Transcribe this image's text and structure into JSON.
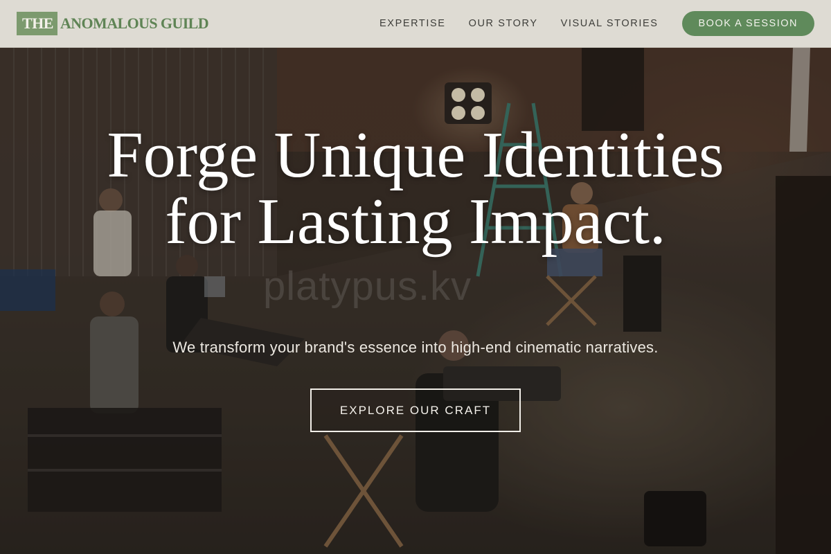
{
  "header": {
    "logo": {
      "highlight": "THE",
      "rest": "ANOMALOUS GUILD"
    },
    "nav": {
      "items": [
        {
          "label": "EXPERTISE"
        },
        {
          "label": "OUR STORY"
        },
        {
          "label": "VISUAL STORIES"
        }
      ],
      "cta_label": "BOOK A SESSION"
    }
  },
  "hero": {
    "title": "Forge Unique Identities for Lasting Impact.",
    "subtitle": "We transform your brand's essence into high-end cinematic narratives.",
    "button_label": "EXPLORE OUR CRAFT",
    "watermark": "platypus.kv"
  },
  "colors": {
    "header_bg": "#dedbd3",
    "brand_green": "#5f8a5b",
    "logo_box": "#7c9a6e",
    "hero_text": "#ffffff"
  },
  "icons": {
    "background": "film-set-photo"
  }
}
